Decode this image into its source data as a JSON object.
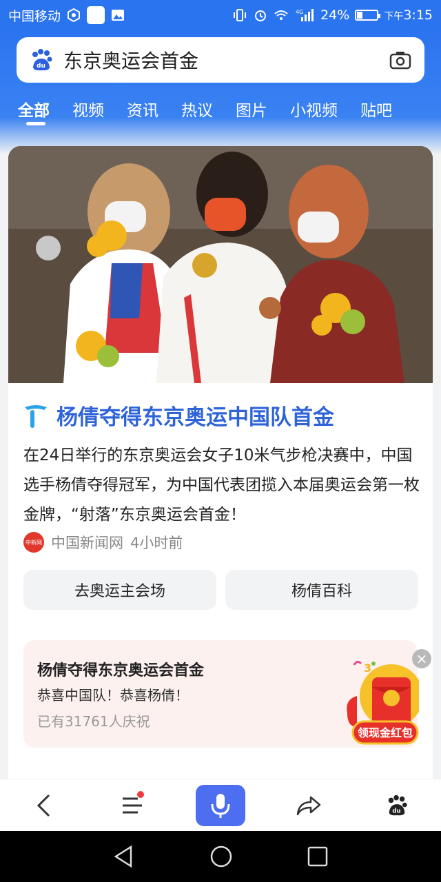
{
  "status_bar": {
    "carrier": "中国移动",
    "battery_percent": "24%",
    "network": "4G",
    "time_prefix": "下午",
    "time": "3:15",
    "battery_level": 0.24
  },
  "search": {
    "query": "东京奥运会首金",
    "logo": "baidu-paw-icon",
    "camera": "camera-icon"
  },
  "tabs": [
    {
      "label": "全部",
      "active": true
    },
    {
      "label": "视频"
    },
    {
      "label": "资讯"
    },
    {
      "label": "热议"
    },
    {
      "label": "图片"
    },
    {
      "label": "小视频"
    },
    {
      "label": "贴吧"
    }
  ],
  "result": {
    "headline": "杨倩夺得东京奥运中国队首金",
    "summary": "在24日举行的东京奥运会女子10米气步枪决赛中，中国选手杨倩夺得冠军，为中国代表团揽入本届奥运会第一枚金牌，“射落”东京奥运会首金！",
    "source_name": "中国新闻网",
    "source_time": "4小时前",
    "source_logo_text": "中新网",
    "actions": [
      "去奥运主会场",
      "杨倩百科"
    ]
  },
  "promo": {
    "title": "杨倩夺得东京奥运会首金",
    "subtitle": "恭喜中国队！恭喜杨倩！",
    "count_text": "已有31761人庆祝",
    "redpack_label": "领现金红包",
    "close_symbol": "×"
  },
  "toolbar": {
    "items": [
      "back-icon",
      "menu-icon",
      "mic-icon",
      "share-icon",
      "baidu-paw-icon"
    ]
  },
  "colors": {
    "brand_blue": "#2b74f0",
    "headline_blue": "#2f64d8",
    "mic_blue": "#4e6ef2"
  }
}
